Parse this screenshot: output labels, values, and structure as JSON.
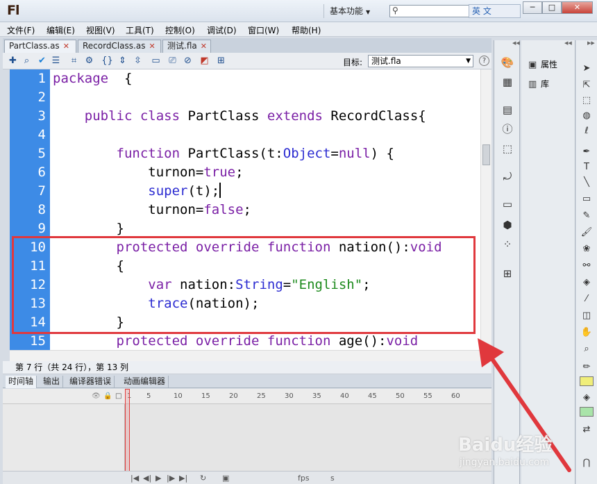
{
  "titlebar": {
    "logo": "Fl",
    "workspace": "基本功能",
    "search_placeholder": "",
    "ime_label": "英 文",
    "btn_min": "─",
    "btn_max": "□",
    "btn_close": "✕"
  },
  "menu": [
    "文件(F)",
    "编辑(E)",
    "视图(V)",
    "工具(T)",
    "控制(O)",
    "调试(D)",
    "窗口(W)",
    "帮助(H)"
  ],
  "tabs": [
    {
      "label": "PartClass.as",
      "active": true
    },
    {
      "label": "RecordClass.as",
      "active": false
    },
    {
      "label": "测试.fla",
      "active": false
    }
  ],
  "toolbar": {
    "target_label": "目标:",
    "target_value": "测试.fla",
    "help": "?"
  },
  "code": {
    "line_numbers": [
      "1",
      "2",
      "3",
      "4",
      "5",
      "6",
      "7",
      "8",
      "9",
      "10",
      "11",
      "12",
      "13",
      "14",
      "15"
    ],
    "cursor_line": 7
  },
  "statusbar": {
    "text": "第 7 行（共 24 行），第 13 列"
  },
  "timeline": {
    "tabs": [
      "时间轴",
      "输出",
      "编译器错误",
      "动画编辑器"
    ],
    "ticks": [
      "1",
      "5",
      "10",
      "15",
      "20",
      "25",
      "30",
      "35",
      "40",
      "45",
      "50",
      "55",
      "60"
    ],
    "fps_label": "fps",
    "s_label": "s"
  },
  "panels": {
    "properties": "属性",
    "library": "库"
  },
  "watermark": {
    "text": "Baidu经验",
    "sub": "jingyan.baidu.com"
  },
  "colors": {
    "gutter": "#3d8be6",
    "keyword": "#7a1fa5",
    "function": "#2b2bd1",
    "string": "#1c8a1c",
    "highlight_box": "#e0383d"
  }
}
